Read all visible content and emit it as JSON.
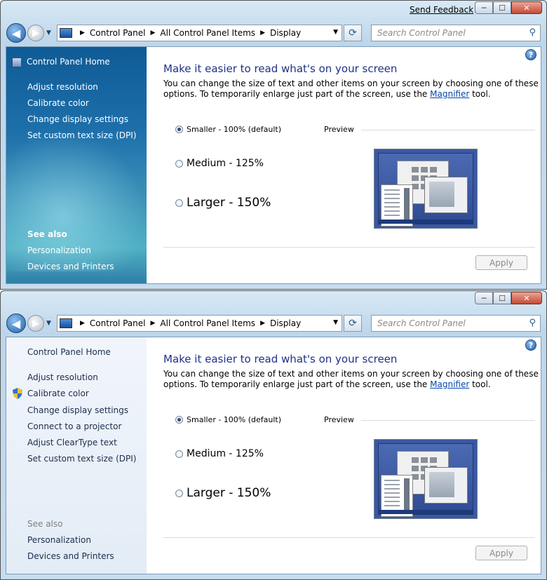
{
  "window1": {
    "titlebar": {
      "send_feedback": "Send Feedback",
      "min": "─",
      "max": "☐",
      "close": "✕"
    },
    "breadcrumb": [
      "Control Panel",
      "All Control Panel Items",
      "Display"
    ],
    "search_placeholder": "Search Control Panel",
    "sidebar": {
      "home": "Control Panel Home",
      "links": [
        "Adjust resolution",
        "Calibrate color",
        "Change display settings",
        "Set custom text size (DPI)"
      ],
      "see_also_title": "See also",
      "see_also": [
        "Personalization",
        "Devices and Printers"
      ]
    },
    "main": {
      "heading": "Make it easier to read what's on your screen",
      "desc_before": "You can change the size of text and other items on your screen by choosing one of these options. To temporarily enlarge just part of the screen, use the ",
      "desc_link": "Magnifier",
      "desc_after": " tool.",
      "options": [
        {
          "label": "Smaller - 100% (default)",
          "checked": true
        },
        {
          "label": "Medium - 125%",
          "checked": false
        },
        {
          "label": "Larger - 150%",
          "checked": false
        }
      ],
      "preview_label": "Preview",
      "apply": "Apply"
    }
  },
  "window2": {
    "titlebar": {
      "min": "─",
      "max": "☐",
      "close": "✕"
    },
    "breadcrumb": [
      "Control Panel",
      "All Control Panel Items",
      "Display"
    ],
    "search_placeholder": "Search Control Panel",
    "sidebar": {
      "home": "Control Panel Home",
      "links": [
        "Adjust resolution",
        "Calibrate color",
        "Change display settings",
        "Connect to a projector",
        "Adjust ClearType text",
        "Set custom text size (DPI)"
      ],
      "see_also_title": "See also",
      "see_also": [
        "Personalization",
        "Devices and Printers"
      ]
    },
    "main": {
      "heading": "Make it easier to read what's on your screen",
      "desc_before": "You can change the size of text and other items on your screen by choosing one of these options. To temporarily enlarge just part of the screen, use the ",
      "desc_link": "Magnifier",
      "desc_after": " tool.",
      "options": [
        {
          "label": "Smaller - 100% (default)",
          "checked": true
        },
        {
          "label": "Medium - 125%",
          "checked": false
        },
        {
          "label": "Larger - 150%",
          "checked": false
        }
      ],
      "preview_label": "Preview",
      "apply": "Apply"
    }
  }
}
